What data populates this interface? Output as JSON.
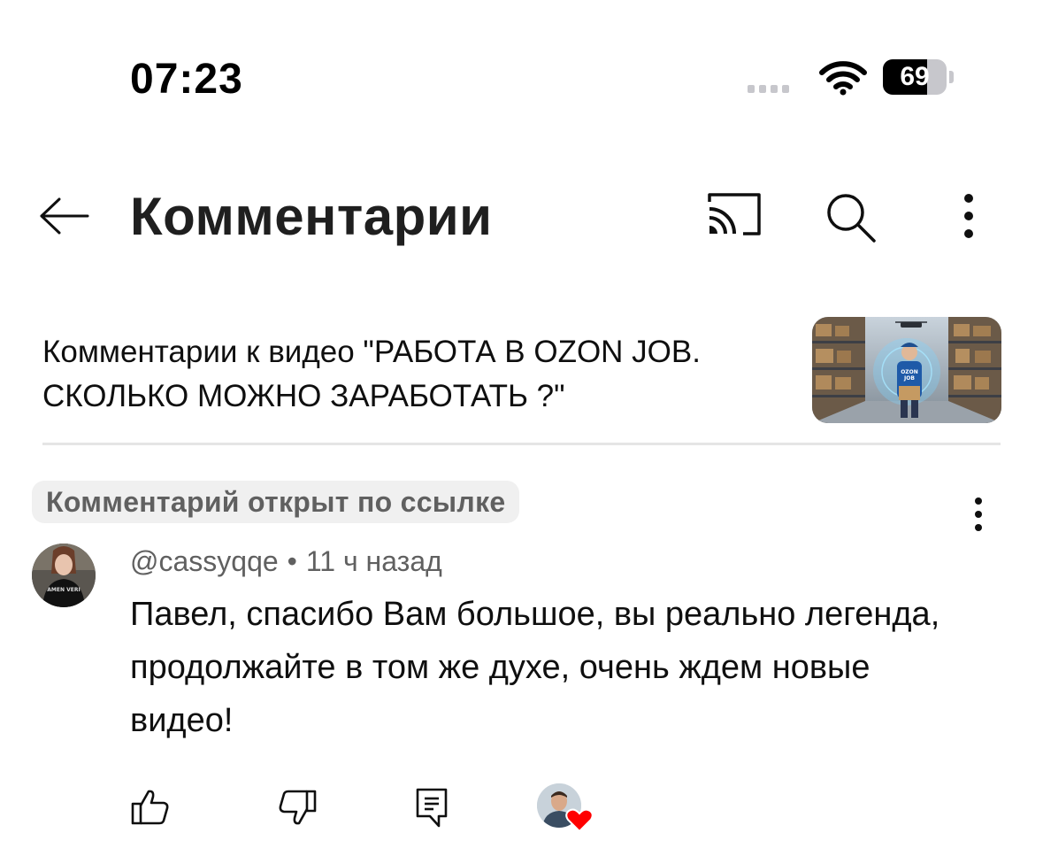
{
  "status_bar": {
    "time": "07:23",
    "battery_percent": "69",
    "battery_level": 0.69,
    "wifi_icon": "wifi-icon",
    "signal_icon": "cellular-signal-icon"
  },
  "header": {
    "title": "Комментарии",
    "back_icon": "arrow-left-icon",
    "cast_icon": "cast-icon",
    "search_icon": "search-icon",
    "more_icon": "more-vertical-icon"
  },
  "video": {
    "caption": "Комментарии к видео \"РАБОТА В OZON JOB. СКОЛЬКО МОЖНО ЗАРАБОТАТЬ ?\"",
    "thumbnail_text": "OZON JOB"
  },
  "comment": {
    "badge": "Комментарий открыт по ссылке",
    "author": "@cassyqqe",
    "separator": "•",
    "time_ago": "11 ч назад",
    "text": "Павел, спасибо Вам большое, вы реально легенда, продолжайте в том же духе, очень ждем новые видео!",
    "avatar_shirt_text": "AMEN VERI",
    "actions": {
      "like_icon": "thumbs-up-icon",
      "dislike_icon": "thumbs-down-icon",
      "reply_icon": "reply-comment-icon",
      "creator_heart_icon": "heart-icon"
    }
  },
  "colors": {
    "text_primary": "#0f0f0f",
    "text_secondary": "#606060",
    "badge_bg": "#f0f0f0",
    "divider": "#e5e5e5",
    "heart": "#ff0000"
  }
}
